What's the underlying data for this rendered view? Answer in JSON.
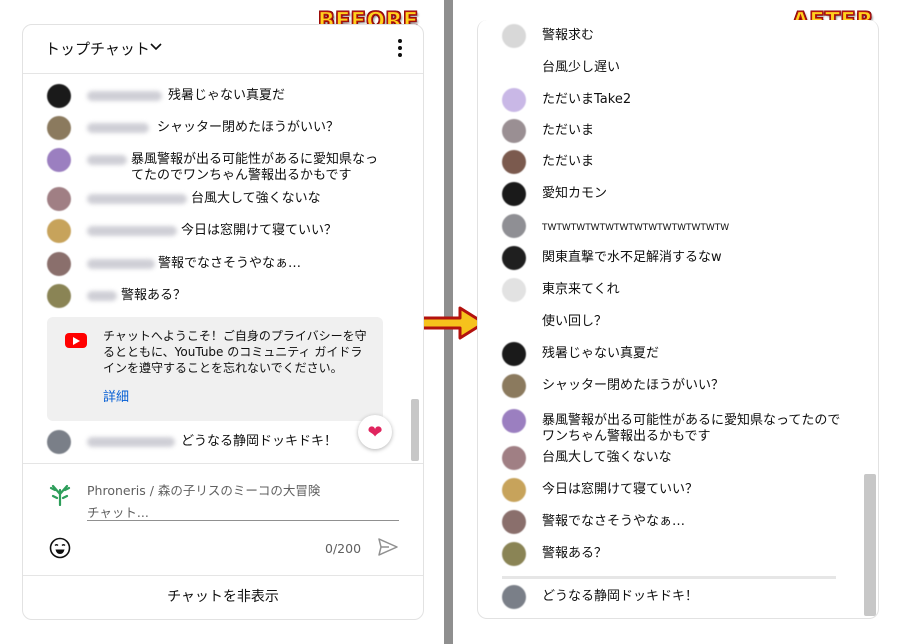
{
  "labels": {
    "before": "BEFORE",
    "after": "AFTER"
  },
  "before": {
    "header_title": "トップチャット",
    "messages": [
      {
        "text": "残暑じゃない真夏だ",
        "avatar_color": "#1a1a1a"
      },
      {
        "text": "シャッター閉めたほうがいい？",
        "avatar_color": "#8b7a5e"
      },
      {
        "text": "暴風警報が出る可能性があるに愛知県なってたのでワンちゃん警報出るかもです",
        "avatar_color": "#9b7fc0"
      },
      {
        "text": "台風大して強くないな",
        "avatar_color": "#a07f84"
      },
      {
        "text": "今日は窓開けて寝ていい？",
        "avatar_color": "#c7a35b"
      },
      {
        "text": "警報でなさそうやなぁ…",
        "avatar_color": "#8a6f6c"
      },
      {
        "text": "警報ある？",
        "avatar_color": "#8a8455"
      }
    ],
    "welcome_text": "チャットへようこそ！ご自身のプライバシーを守るとともに、YouTube のコミュニティ ガイドラインを遵守することを忘れないでください。",
    "welcome_link": "詳細",
    "last_message": {
      "text": "どうなる静岡ドッキドキ！",
      "avatar_color": "#7a7f88"
    },
    "channel_name": "Phroneris",
    "channel_sub": " / 森の子リスのミーコの大冒険",
    "chat_placeholder": "チャット...",
    "counter": "0/200",
    "footer": "チャットを非表示",
    "icons": {
      "emoji": "emoji-icon",
      "send": "send-icon",
      "heart": "heart-icon",
      "more": "more-icon",
      "youtube": "youtube-logo-icon"
    }
  },
  "after": {
    "messages": [
      {
        "text": "警報求む",
        "avatar_color": "#d8d8d8"
      },
      {
        "text": "台風少し遅い",
        "avatar_color": ""
      },
      {
        "text": "ただいまTake2",
        "avatar_color": "#c9b8e6"
      },
      {
        "text": "ただいま",
        "avatar_color": "#9a8f93"
      },
      {
        "text": "ただいま",
        "avatar_color": "#7b5a4e"
      },
      {
        "text": "愛知カモン",
        "avatar_color": "#1a1a1a"
      },
      {
        "text": "TWTWTWTWTWTWTWTWTWTWTWTWTW",
        "avatar_color": "#8f8f94"
      },
      {
        "text": "関東直撃で水不足解消するなw",
        "avatar_color": "#1f1f1f"
      },
      {
        "text": "東京来てくれ",
        "avatar_color": "#e2e2e2"
      },
      {
        "text": "使い回し？",
        "avatar_color": ""
      },
      {
        "text": "残暑じゃない真夏だ",
        "avatar_color": "#1a1a1a"
      },
      {
        "text": "シャッター閉めたほうがいい？",
        "avatar_color": "#8b7a5e"
      },
      {
        "text": "暴風警報が出る可能性があるに愛知県なってたのでワンちゃん警報出るかもです",
        "avatar_color": "#9b7fc0"
      },
      {
        "text": "台風大して強くないな",
        "avatar_color": "#a07f84"
      },
      {
        "text": "今日は窓開けて寝ていい？",
        "avatar_color": "#c7a35b"
      },
      {
        "text": "警報でなさそうやなぁ…",
        "avatar_color": "#8a6f6c"
      },
      {
        "text": "警報ある？",
        "avatar_color": "#8a8455"
      },
      {
        "text": "どうなる静岡ドッキドキ！",
        "avatar_color": "#7a7f88"
      }
    ]
  }
}
